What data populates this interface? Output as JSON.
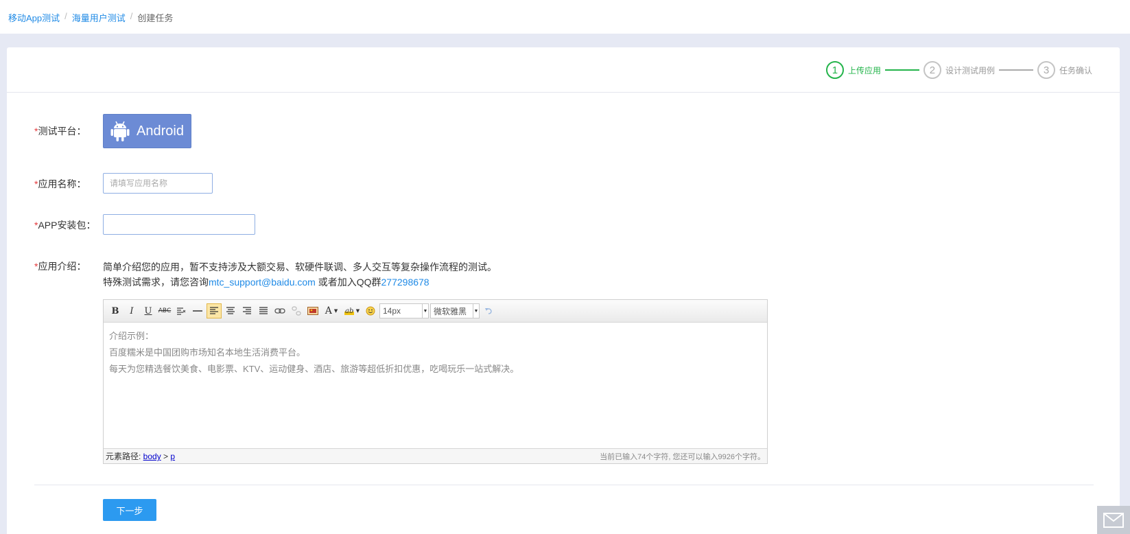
{
  "breadcrumb": {
    "items": [
      "移动App测试",
      "海量用户测试"
    ],
    "current": "创建任务",
    "separator": "/"
  },
  "steps": [
    {
      "number": "1",
      "label": "上传应用",
      "active": true
    },
    {
      "number": "2",
      "label": "设计测试用例",
      "active": false
    },
    {
      "number": "3",
      "label": "任务确认",
      "active": false
    }
  ],
  "form": {
    "required_mark": "*",
    "platform": {
      "label": "测试平台：",
      "button": "Android"
    },
    "app_name": {
      "label": "应用名称：",
      "placeholder": "请填写应用名称",
      "value": ""
    },
    "app_package": {
      "label": "APP安装包：",
      "value": ""
    },
    "intro": {
      "label": "应用介绍：",
      "line1": "简单介绍您的应用，暂不支持涉及大额交易、软硬件联调、多人交互等复杂操作流程的测试。",
      "line2_prefix": "特殊测试需求，请您咨询",
      "email": "mtc_support@baidu.com",
      "line2_mid": " 或者加入QQ群",
      "qq_group": "277298678"
    }
  },
  "editor": {
    "toolbar": {
      "bold": "B",
      "italic": "I",
      "underline": "U",
      "strike": "ABC",
      "font_size": "14px",
      "font_family": "微软雅黑"
    },
    "body_lines": [
      "介绍示例：",
      "百度糯米是中国团购市场知名本地生活消费平台。",
      "每天为您精选餐饮美食、电影票、KTV、运动健身、酒店、旅游等超低折扣优惠，吃喝玩乐一站式解决。"
    ],
    "status": {
      "path_label": "元素路径: ",
      "path_body": "body",
      "path_sep": " > ",
      "path_p": "p",
      "count": "当前已输入74个字符, 您还可以输入9926个字符。"
    }
  },
  "next_button": "下一步",
  "colors": {
    "accent": "#2c9af0",
    "step_active": "#24b44b",
    "android": "#6c8bd5",
    "required": "#e4393c"
  }
}
